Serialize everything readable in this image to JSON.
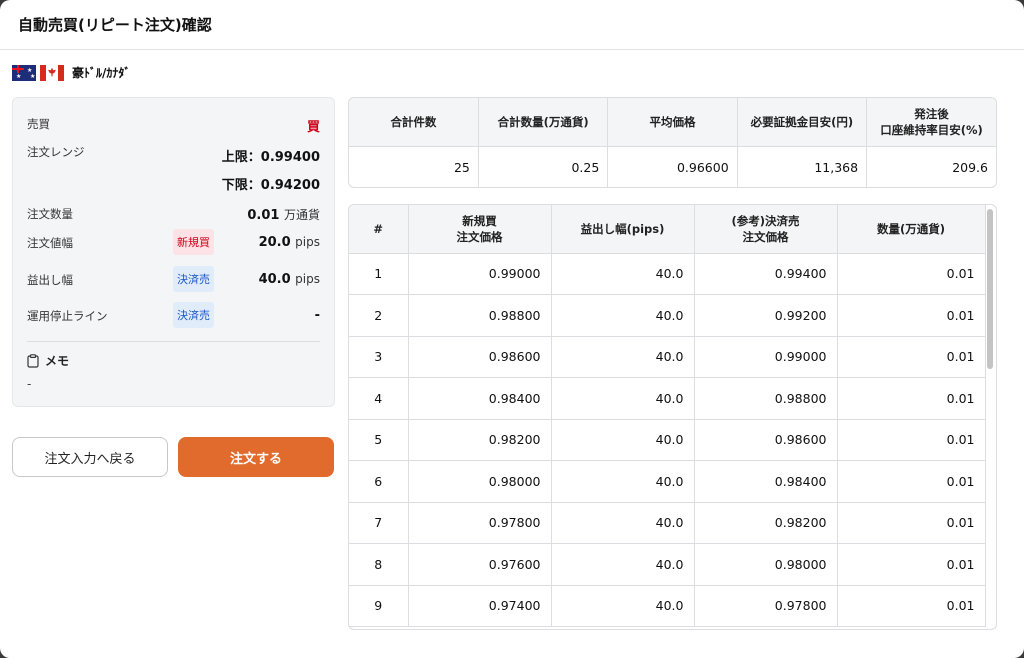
{
  "title": "自動売買(リピート注文)確認",
  "pair": {
    "name": "豪ﾄﾞﾙ/ｶﾅﾀﾞ",
    "base_flag_icon": "australia-flag-icon",
    "quote_flag_icon": "canada-flag-icon"
  },
  "summary": {
    "side": {
      "label": "売買",
      "value": "買",
      "color": "#d0021b"
    },
    "range": {
      "label": "注文レンジ",
      "upper": "上限：0.99400",
      "lower": "下限：0.94200"
    },
    "quantity": {
      "label": "注文数量",
      "value": "0.01",
      "unit": "万通貨"
    },
    "spacing": {
      "label": "注文値幅",
      "badge": "新規買",
      "value": "20.0",
      "unit": "pips"
    },
    "take_profit": {
      "label": "益出し幅",
      "badge": "決済売",
      "value": "40.0",
      "unit": "pips"
    },
    "stop_line": {
      "label": "運用停止ライン",
      "badge": "決済売",
      "value": "-"
    },
    "memo": {
      "label": "メモ",
      "value": "-",
      "icon": "clipboard-icon"
    }
  },
  "buttons": {
    "back": "注文入力へ戻る",
    "order": "注文する",
    "order_color": "#e06b2c"
  },
  "stats": {
    "headers": [
      "合計件数",
      "合計数量(万通貨)",
      "平均価格",
      "必要証拠金目安(円)",
      "発注後\n口座維持率目安(%)"
    ],
    "values": [
      "25",
      "0.25",
      "0.96600",
      "11,368",
      "209.6"
    ]
  },
  "orders": {
    "headers": [
      "#",
      "新規買\n注文価格",
      "益出し幅(pips)",
      "(参考)決済売\n注文価格",
      "数量(万通貨)"
    ],
    "rows": [
      [
        "1",
        "0.99000",
        "40.0",
        "0.99400",
        "0.01"
      ],
      [
        "2",
        "0.98800",
        "40.0",
        "0.99200",
        "0.01"
      ],
      [
        "3",
        "0.98600",
        "40.0",
        "0.99000",
        "0.01"
      ],
      [
        "4",
        "0.98400",
        "40.0",
        "0.98800",
        "0.01"
      ],
      [
        "5",
        "0.98200",
        "40.0",
        "0.98600",
        "0.01"
      ],
      [
        "6",
        "0.98000",
        "40.0",
        "0.98400",
        "0.01"
      ],
      [
        "7",
        "0.97800",
        "40.0",
        "0.98200",
        "0.01"
      ],
      [
        "8",
        "0.97600",
        "40.0",
        "0.98000",
        "0.01"
      ],
      [
        "9",
        "0.97400",
        "40.0",
        "0.97800",
        "0.01"
      ]
    ]
  }
}
